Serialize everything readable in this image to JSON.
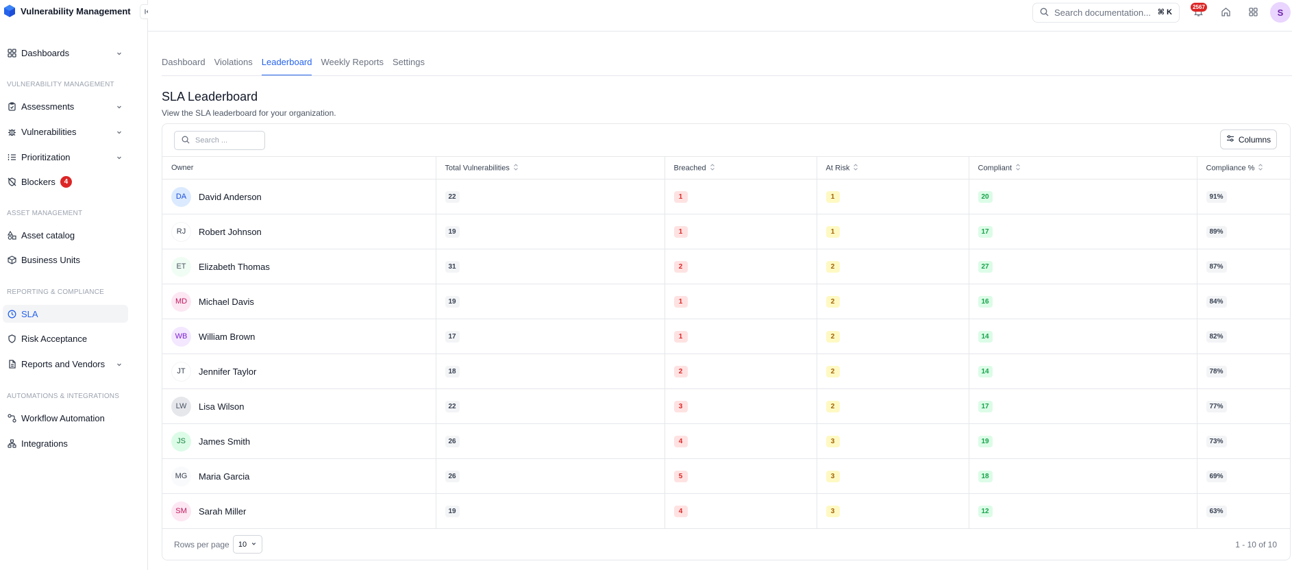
{
  "app": {
    "title": "Vulnerability Management"
  },
  "sidebar": {
    "items": [
      {
        "key": "dashboards",
        "label": "Dashboards",
        "icon": "grid-icon",
        "chevron": true
      },
      {
        "key": "assessments",
        "label": "Assessments",
        "icon": "clipboard-icon",
        "chevron": true
      },
      {
        "key": "vulnerabilities",
        "label": "Vulnerabilities",
        "icon": "bug-icon",
        "chevron": true
      },
      {
        "key": "prioritization",
        "label": "Prioritization",
        "icon": "list-ordered-icon",
        "chevron": true
      },
      {
        "key": "blockers",
        "label": "Blockers",
        "icon": "shield-off-icon",
        "badge": "4"
      },
      {
        "key": "asset-catalog",
        "label": "Asset catalog",
        "icon": "shapes-icon"
      },
      {
        "key": "business-units",
        "label": "Business Units",
        "icon": "box-icon"
      },
      {
        "key": "sla",
        "label": "SLA",
        "icon": "clock-icon",
        "active": true
      },
      {
        "key": "risk-acceptance",
        "label": "Risk Acceptance",
        "icon": "shield-icon"
      },
      {
        "key": "reports-vendors",
        "label": "Reports and Vendors",
        "icon": "file-icon",
        "chevron": true
      },
      {
        "key": "workflow-automation",
        "label": "Workflow Automation",
        "icon": "workflow-icon"
      },
      {
        "key": "integrations",
        "label": "Integrations",
        "icon": "network-icon"
      }
    ],
    "sections": [
      "Vulnerability Management",
      "Asset Management",
      "Reporting & Compliance",
      "Automations & Integrations"
    ]
  },
  "topbar": {
    "search_placeholder": "Search documentation...",
    "shortcut": "⌘ K",
    "notification_count": "2567",
    "user_initial": "S"
  },
  "tabs": [
    "Dashboard",
    "Violations",
    "Leaderboard",
    "Weekly Reports",
    "Settings"
  ],
  "active_tab": "Leaderboard",
  "page": {
    "title": "SLA Leaderboard",
    "subtitle": "View the SLA leaderboard for your organization."
  },
  "table": {
    "search_placeholder": "Search ...",
    "columns_button": "Columns",
    "headers": [
      "Owner",
      "Total Vulnerabilities",
      "Breached",
      "At Risk",
      "Compliant",
      "Compliance %"
    ],
    "rows": [
      {
        "initials": "DA",
        "name": "David Anderson",
        "total": "22",
        "breached": "1",
        "at_risk": "1",
        "compliant": "20",
        "compliance": "91%",
        "avatar_bg": "#dbeafe",
        "avatar_fg": "#1d4ed8"
      },
      {
        "initials": "RJ",
        "name": "Robert Johnson",
        "total": "19",
        "breached": "1",
        "at_risk": "1",
        "compliant": "17",
        "compliance": "89%",
        "avatar_bg": "#ffffff",
        "avatar_fg": "#374151"
      },
      {
        "initials": "ET",
        "name": "Elizabeth Thomas",
        "total": "31",
        "breached": "2",
        "at_risk": "2",
        "compliant": "27",
        "compliance": "87%",
        "avatar_bg": "#f0fdf4",
        "avatar_fg": "#4b5563"
      },
      {
        "initials": "MD",
        "name": "Michael Davis",
        "total": "19",
        "breached": "1",
        "at_risk": "2",
        "compliant": "16",
        "compliance": "84%",
        "avatar_bg": "#fce7f3",
        "avatar_fg": "#be185d"
      },
      {
        "initials": "WB",
        "name": "William Brown",
        "total": "17",
        "breached": "1",
        "at_risk": "2",
        "compliant": "14",
        "compliance": "82%",
        "avatar_bg": "#f3e8ff",
        "avatar_fg": "#7e22ce"
      },
      {
        "initials": "JT",
        "name": "Jennifer Taylor",
        "total": "18",
        "breached": "2",
        "at_risk": "2",
        "compliant": "14",
        "compliance": "78%",
        "avatar_bg": "#ffffff",
        "avatar_fg": "#374151"
      },
      {
        "initials": "LW",
        "name": "Lisa Wilson",
        "total": "22",
        "breached": "3",
        "at_risk": "2",
        "compliant": "17",
        "compliance": "77%",
        "avatar_bg": "#e5e7eb",
        "avatar_fg": "#4b5563"
      },
      {
        "initials": "JS",
        "name": "James Smith",
        "total": "26",
        "breached": "4",
        "at_risk": "3",
        "compliant": "19",
        "compliance": "73%",
        "avatar_bg": "#dcfce7",
        "avatar_fg": "#15803d"
      },
      {
        "initials": "MG",
        "name": "Maria Garcia",
        "total": "26",
        "breached": "5",
        "at_risk": "3",
        "compliant": "18",
        "compliance": "69%",
        "avatar_bg": "#f9fafb",
        "avatar_fg": "#374151"
      },
      {
        "initials": "SM",
        "name": "Sarah Miller",
        "total": "19",
        "breached": "4",
        "at_risk": "3",
        "compliant": "12",
        "compliance": "63%",
        "avatar_bg": "#fce7f3",
        "avatar_fg": "#be185d"
      }
    ],
    "rows_per_page_label": "Rows per page",
    "rows_per_page": "10",
    "pagination": "1 - 10 of 10"
  },
  "colors": {
    "accent": "#2563eb",
    "danger": "#dc2626",
    "warning": "#a16207",
    "success": "#16a34a"
  }
}
